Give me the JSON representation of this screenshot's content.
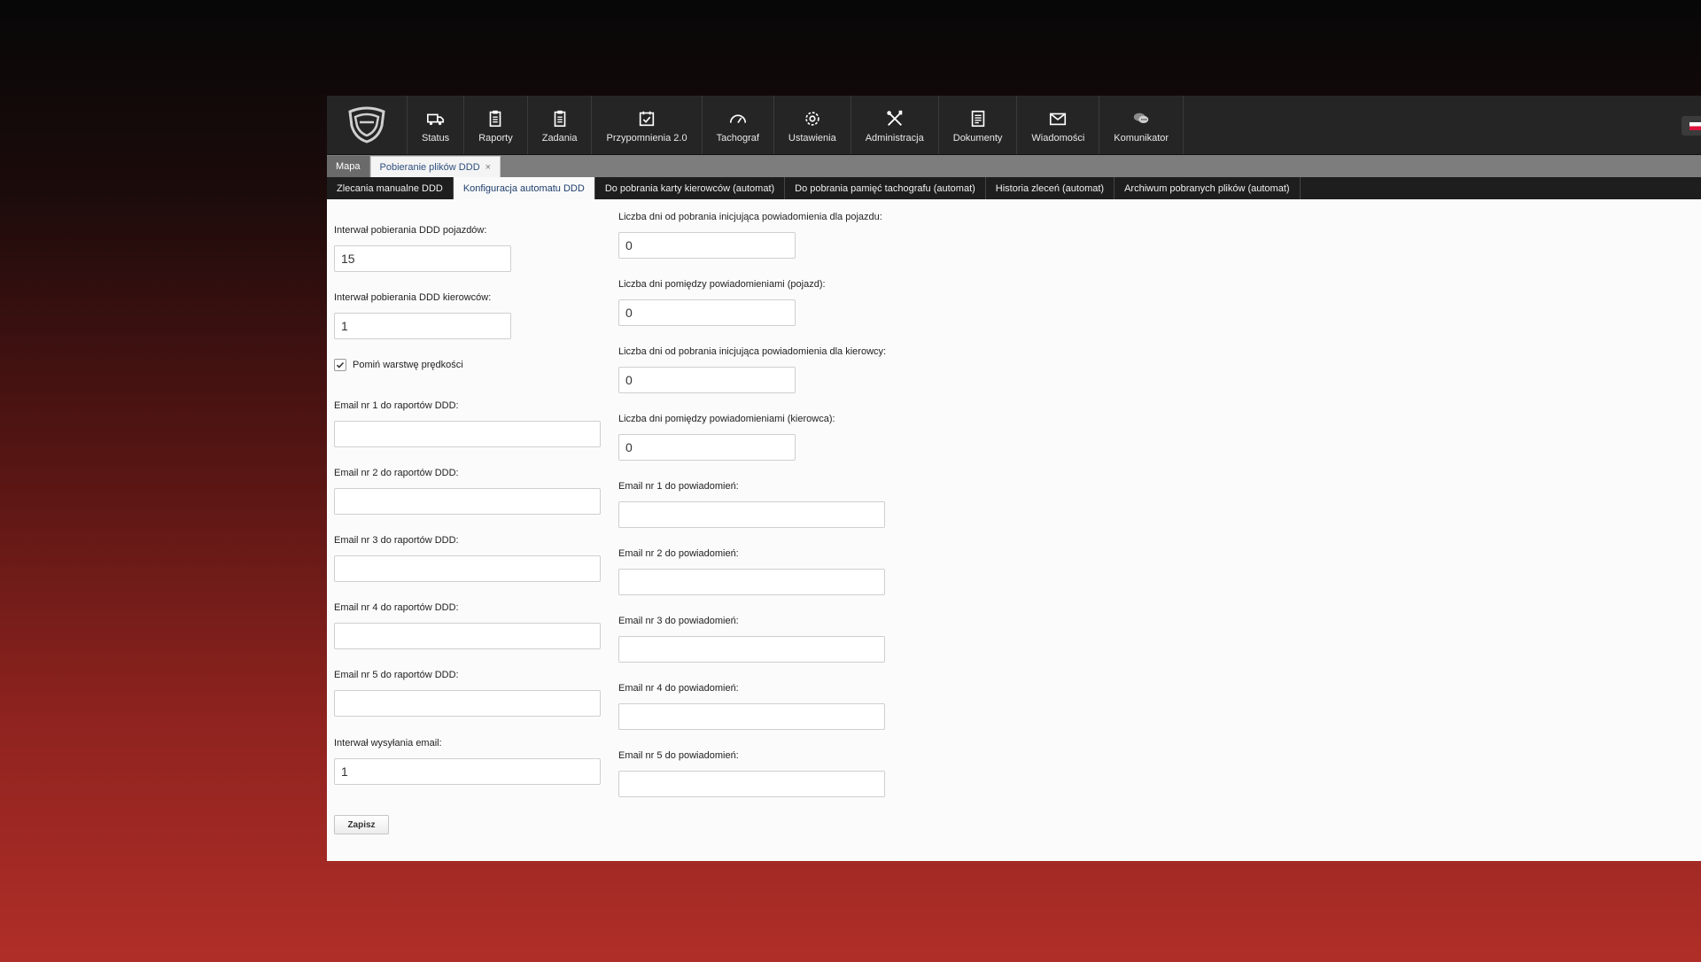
{
  "nav": {
    "items": [
      {
        "label": "Status",
        "icon": "truck-icon"
      },
      {
        "label": "Raporty",
        "icon": "clipboard-icon"
      },
      {
        "label": "Zadania",
        "icon": "task-list-icon"
      },
      {
        "label": "Przypomnienia 2.0",
        "icon": "calendar-check-icon"
      },
      {
        "label": "Tachograf",
        "icon": "gauge-icon"
      },
      {
        "label": "Ustawienia",
        "icon": "gear-icon"
      },
      {
        "label": "Administracja",
        "icon": "tools-icon"
      },
      {
        "label": "Dokumenty",
        "icon": "document-icon"
      },
      {
        "label": "Wiadomości",
        "icon": "envelope-icon"
      },
      {
        "label": "Komunikator",
        "icon": "chat-icon"
      }
    ]
  },
  "tabs_primary": {
    "map": "Mapa",
    "ddd": "Pobieranie plików DDD",
    "close": "×"
  },
  "tabs_secondary": [
    "Zlecania manualne DDD",
    "Konfiguracja automatu DDD",
    "Do pobrania karty kierowców (automat)",
    "Do pobrania pamięć tachografu (automat)",
    "Historia zleceń (automat)",
    "Archiwum pobranych plików (automat)"
  ],
  "form_left": {
    "vehicle_interval": {
      "label": "Interwał pobierania DDD pojazdów:",
      "value": "15"
    },
    "driver_interval": {
      "label": "Interwał pobierania DDD kierowców:",
      "value": "1"
    },
    "skip_speed": {
      "label": "Pomiń warstwę prędkości",
      "checked": true
    },
    "email1": {
      "label": "Email nr 1 do raportów DDD:",
      "value": ""
    },
    "email2": {
      "label": "Email nr 2 do raportów DDD:",
      "value": ""
    },
    "email3": {
      "label": "Email nr 3 do raportów DDD:",
      "value": ""
    },
    "email4": {
      "label": "Email nr 4 do raportów DDD:",
      "value": ""
    },
    "email5": {
      "label": "Email nr 5 do raportów DDD:",
      "value": ""
    },
    "email_interval": {
      "label": "Interwał wysyłania email:",
      "value": "1"
    }
  },
  "form_right": {
    "days_vehicle": {
      "label": "Liczba dni od pobrania inicjująca powiadomienia dla pojazdu:",
      "value": "0"
    },
    "days_between_vehicle": {
      "label": "Liczba dni pomiędzy powiadomieniami (pojazd):",
      "value": "0"
    },
    "days_driver": {
      "label": "Liczba dni od pobrania inicjująca powiadomienia dla kierowcy:",
      "value": "0"
    },
    "days_between_driver": {
      "label": "Liczba dni pomiędzy powiadomieniami (kierowca):",
      "value": "0"
    },
    "notify1": {
      "label": "Email nr 1 do powiadomień:",
      "value": ""
    },
    "notify2": {
      "label": "Email nr 2 do powiadomień:",
      "value": ""
    },
    "notify3": {
      "label": "Email nr 3 do powiadomień:",
      "value": ""
    },
    "notify4": {
      "label": "Email nr 4 do powiadomień:",
      "value": ""
    },
    "notify5": {
      "label": "Email nr 5 do powiadomień:",
      "value": ""
    }
  },
  "save_label": "Zapisz",
  "colors": {
    "nav_bg": "#252525",
    "tab_active_text": "#1e3f6e",
    "background_red": "#b02e28"
  }
}
